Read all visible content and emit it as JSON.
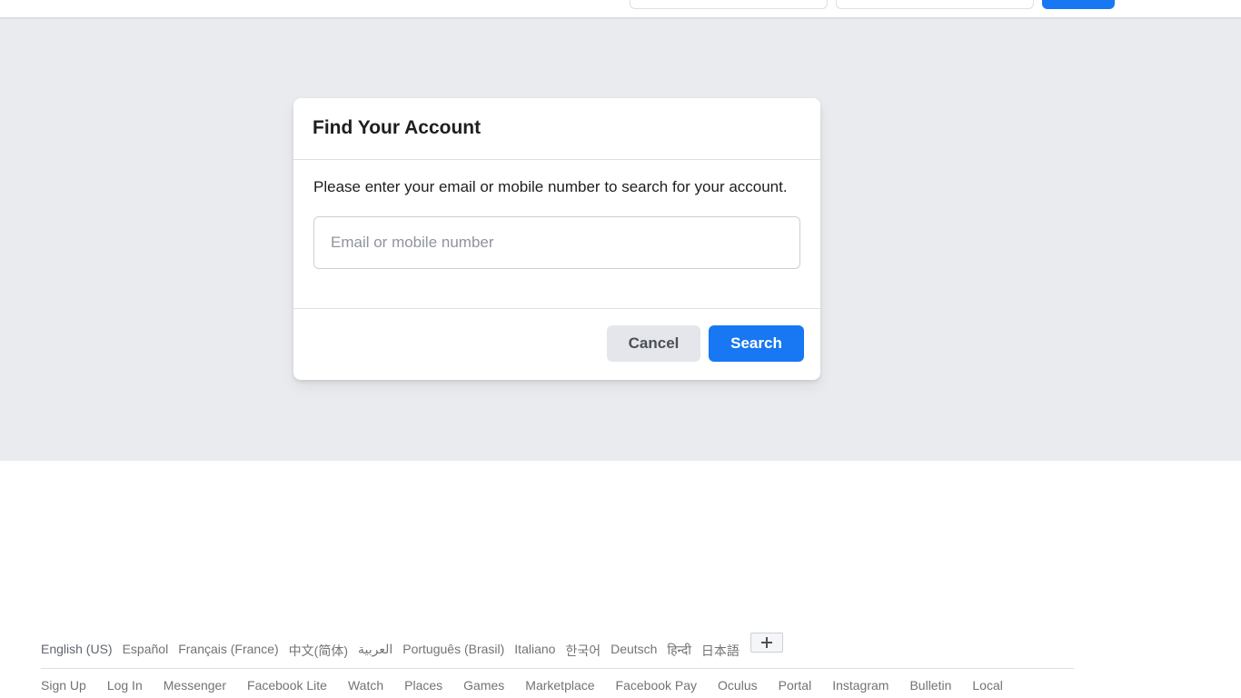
{
  "header": {
    "email_value": "",
    "password_value": "",
    "login_label": ""
  },
  "dialog": {
    "title": "Find Your Account",
    "description": "Please enter your email or mobile number to search for your account.",
    "input_placeholder": "Email or mobile number",
    "input_value": "",
    "cancel_label": "Cancel",
    "search_label": "Search"
  },
  "footer": {
    "languages": [
      "English (US)",
      "Español",
      "Français (France)",
      "中文(简体)",
      "العربية",
      "Português (Brasil)",
      "Italiano",
      "한국어",
      "Deutsch",
      "हिन्दी",
      "日本語"
    ],
    "links": [
      "Sign Up",
      "Log In",
      "Messenger",
      "Facebook Lite",
      "Watch",
      "Places",
      "Games",
      "Marketplace",
      "Facebook Pay",
      "Oculus",
      "Portal",
      "Instagram",
      "Bulletin",
      "Local"
    ]
  },
  "colors": {
    "accent": "#1877f2",
    "background": "#e9ebee",
    "secondary_button": "#e4e6eb"
  },
  "icons": {
    "more_languages": "plus-icon"
  }
}
